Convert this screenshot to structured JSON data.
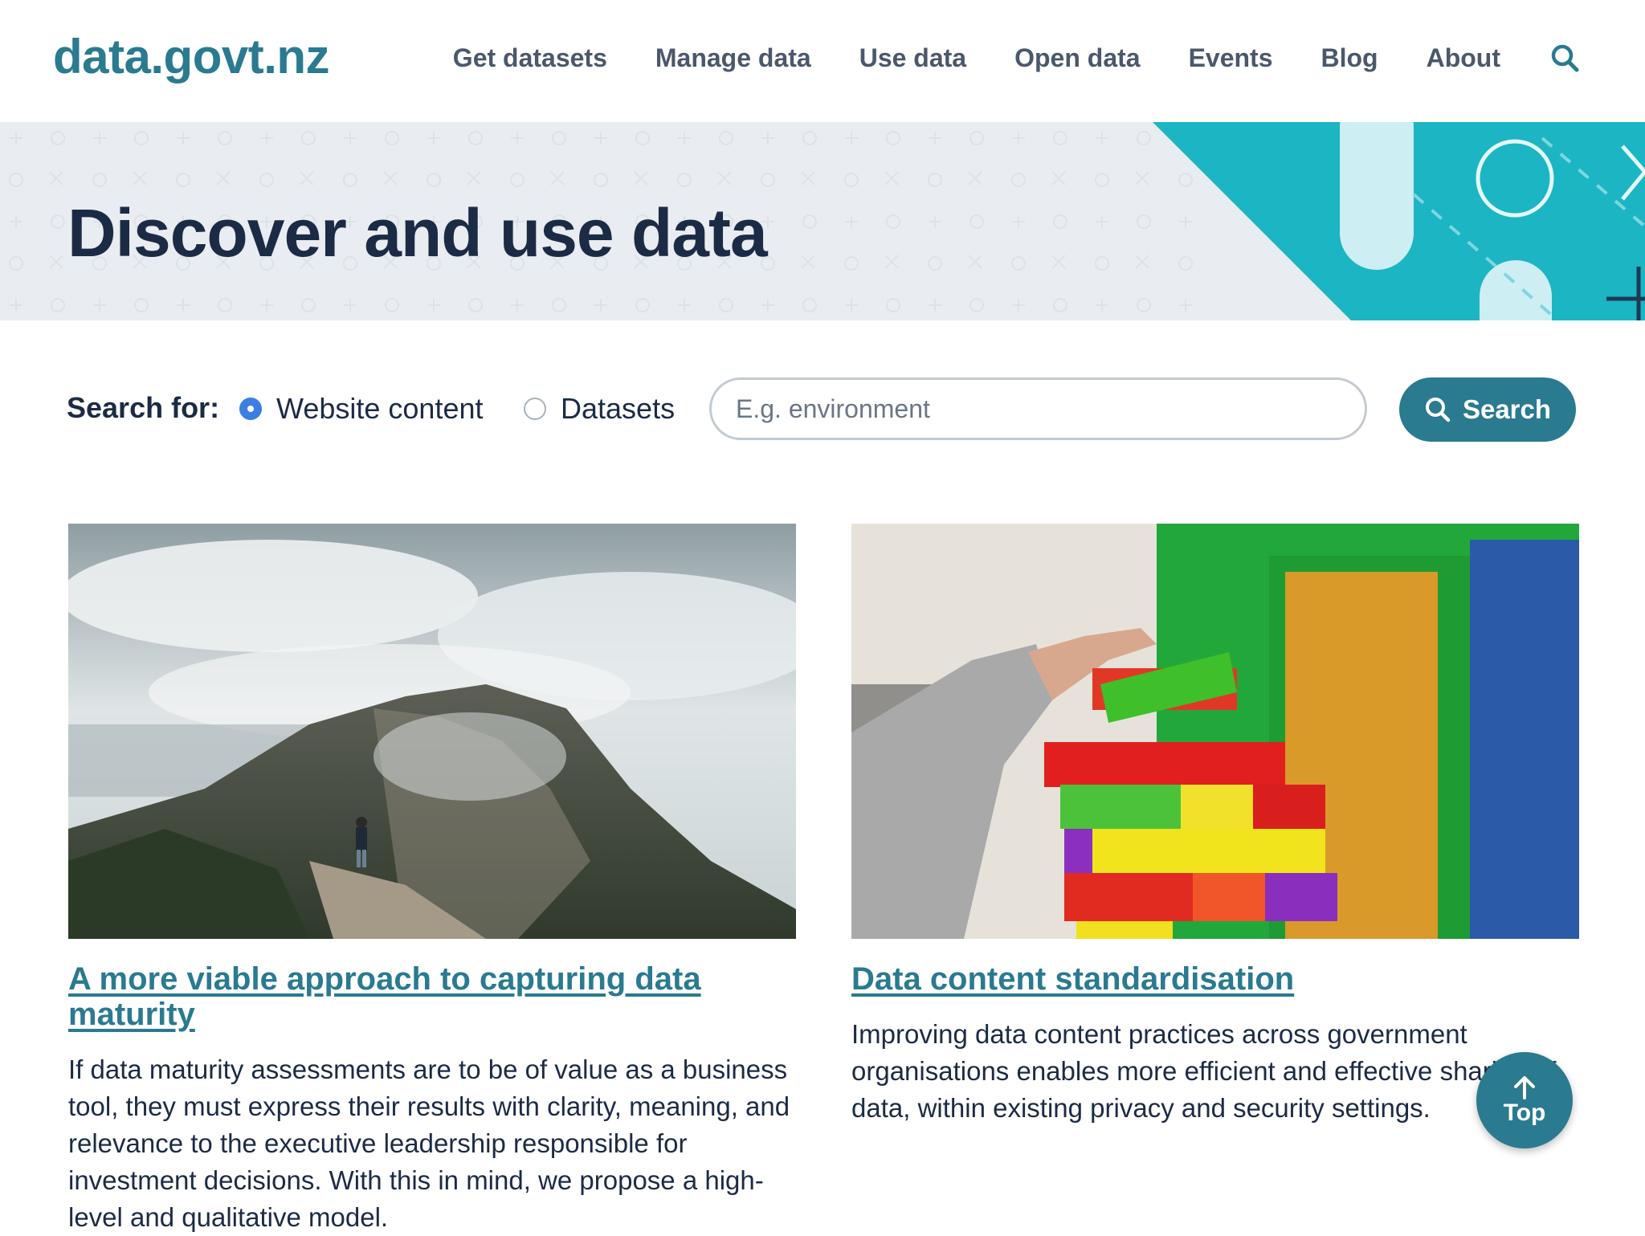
{
  "header": {
    "logo": "data.govt.nz",
    "nav": [
      "Get datasets",
      "Manage data",
      "Use data",
      "Open data",
      "Events",
      "Blog",
      "About"
    ],
    "search_icon": "search-icon"
  },
  "hero": {
    "title": "Discover and use data"
  },
  "search": {
    "label": "Search for:",
    "options": [
      {
        "label": "Website content",
        "selected": true
      },
      {
        "label": "Datasets",
        "selected": false
      }
    ],
    "placeholder": "E.g. environment",
    "value": "",
    "button_label": "Search"
  },
  "cards": [
    {
      "image": "mountain-hiker-photo",
      "title": "A more viable approach to capturing data maturity",
      "text": "If data maturity assessments are to be of value as a business tool, they must express their results with clarity, meaning, and relevance to the executive leadership responsible for investment decisions. With this in mind, we propose a high-level and qualitative model."
    },
    {
      "image": "building-blocks-photo",
      "title": "Data content standardisation",
      "text": "Improving data content practices across government organisations enables more efficient and effective sharing of data, within existing privacy and security settings."
    }
  ],
  "back_to_top": {
    "label": "Top",
    "icon": "arrow-up-icon"
  },
  "colors": {
    "brand": "#2a7a90",
    "hero_bg": "#e9edf1",
    "hero_accent": "#1cb5c4",
    "text": "#1c2b45",
    "radio_selected": "#3b7fe0"
  }
}
